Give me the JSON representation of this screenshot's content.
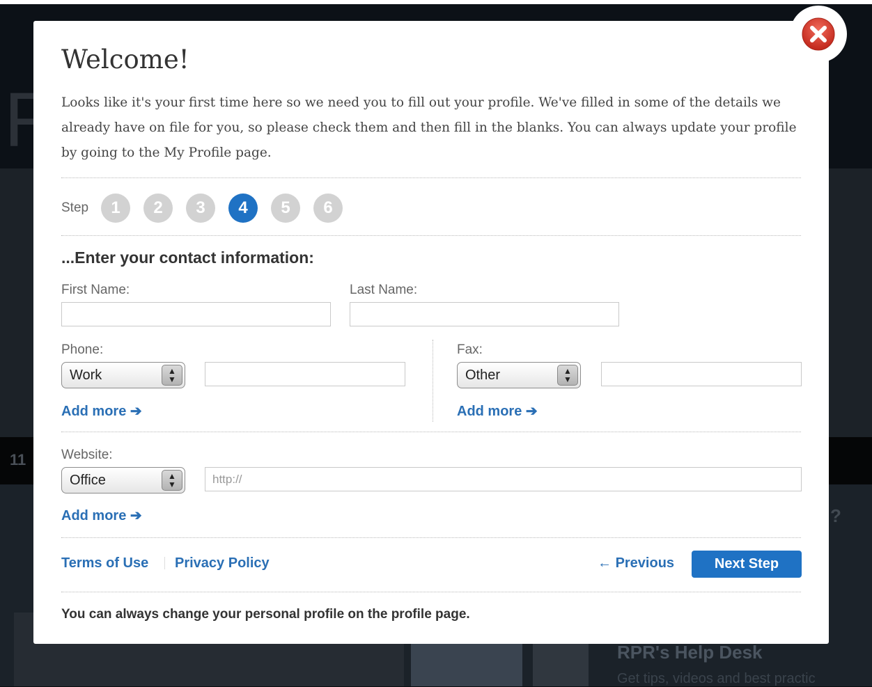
{
  "background": {
    "hero_letter": "F",
    "strip_number": "11",
    "question_mark": "?",
    "help_title": "RPR's Help Desk",
    "help_subtitle": "Get tips, videos and best practic"
  },
  "modal": {
    "title": "Welcome!",
    "intro": "Looks like it's your first time here so we need you to fill out your profile. We've filled in some of the details we already have on file for you, so please check them and then fill in the blanks. You can always update your profile by going to the My Profile page.",
    "step_label": "Step",
    "steps": [
      "1",
      "2",
      "3",
      "4",
      "5",
      "6"
    ],
    "active_step": 4,
    "section_heading": "...Enter your contact information:",
    "first_name": {
      "label": "First Name:",
      "value": ""
    },
    "last_name": {
      "label": "Last Name:",
      "value": ""
    },
    "phone": {
      "label": "Phone:",
      "type": "Work",
      "value": "",
      "add_more": "Add more"
    },
    "fax": {
      "label": "Fax:",
      "type": "Other",
      "value": "",
      "add_more": "Add more"
    },
    "website": {
      "label": "Website:",
      "type": "Office",
      "value": "",
      "placeholder": "http://",
      "add_more": "Add more"
    },
    "footer": {
      "terms": "Terms of Use",
      "privacy": "Privacy Policy",
      "previous": "Previous",
      "next": "Next Step",
      "note": "You can always change your personal profile on the profile page."
    }
  },
  "colors": {
    "accent": "#1f72c4",
    "link": "#2a6fb5",
    "step_inactive": "#d2d2d2",
    "close": "#d9352a"
  }
}
